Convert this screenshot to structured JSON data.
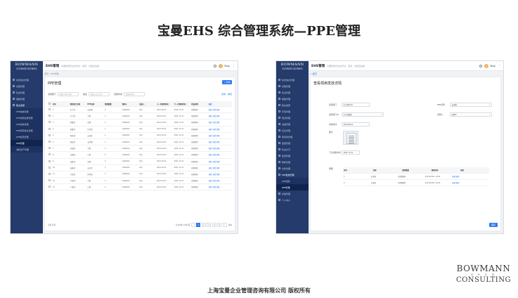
{
  "slide": {
    "title": "宝曼EHS  综合管理系统—PPE管理",
    "footer": "上海宝曼企业管理咨询有限公司 版权所有",
    "brand": {
      "line1": "BOWMANN",
      "line2": "B  E  D  H",
      "line3": "CONSULTING"
    }
  },
  "app": {
    "logo_line1": "BOWMANN",
    "logo_line2": "CONSULTING",
    "name": "EHS管理",
    "slogan": "手握使用安全的环境、职场、合规应提前",
    "user": "Tony",
    "more": "⋮"
  },
  "left": {
    "nav": [
      "综合信息管理",
      "合规管理",
      "隐患管理",
      "事故管理",
      "职业健康",
      "PPE发放管理",
      "PPE领用台账管理",
      "PPE品类管理",
      "PPE库存信息管理",
      "PPE检查管理",
      "PPE管理",
      "消防资产管理"
    ],
    "breadcrumb": "首页 / PPE管理",
    "panel_title": "PPE管理",
    "add_button": "+ 新增",
    "filters": [
      {
        "label": "领用部门",
        "placeholder": "请输入部门名称"
      },
      {
        "label": "姓名",
        "placeholder": "请输入员工姓名"
      },
      {
        "label": "领用时间",
        "placeholder": "请选择时间"
      }
    ],
    "search_button": "查询",
    "reset_button": "重置",
    "columns": [
      "序号",
      "领用部门名称",
      "PPE名称",
      "领用数量",
      "领用人",
      "发放人",
      "上一次领用时间",
      "下一次领用时间",
      "状态说明",
      "操作"
    ],
    "rows": [
      [
        "1",
        "生产部",
        "安全帽",
        "2",
        "LIANGDA",
        "GKJ",
        "2021.02.01",
        "2021.11.01",
        "按期领用",
        "编辑 查看 删除"
      ],
      [
        "2",
        "生产部",
        "手套",
        "3",
        "LIANGDA",
        "GKJ",
        "2021.02.01",
        "2021.11.01",
        "按期领用",
        "编辑 查看 删除"
      ],
      [
        "3",
        "质量部",
        "耳塞",
        "3",
        "LIANGDA",
        "GKJ",
        "2021.02.01",
        "2021.11.01",
        "按期领用",
        "编辑 查看 删除"
      ],
      [
        "4",
        "质量部",
        "护目镜",
        "1",
        "LIANGDA",
        "GKJ",
        "2021.02.01",
        "2021.11.01",
        "按期领用",
        "编辑 查看 删除"
      ],
      [
        "5",
        "物流部",
        "安全鞋",
        "1",
        "LIANGDA",
        "GKJ",
        "2021.02.01",
        "2021.11.01",
        "按期领用",
        "编辑 查看 删除"
      ],
      [
        "6",
        "物流部",
        "安全帽",
        "2",
        "LIANGDA",
        "GKJ",
        "2021.02.01",
        "2021.11.01",
        "按期领用",
        "编辑 查看 删除"
      ],
      [
        "7",
        "仓储部",
        "手套",
        "4",
        "LIANGDA",
        "GKJ",
        "2021.02.01",
        "2021.11.01",
        "按期领用",
        "编辑 查看 删除"
      ],
      [
        "8",
        "仓储部",
        "口罩",
        "5",
        "LIANGDA",
        "GKJ",
        "2021.02.01",
        "2021.11.01",
        "按期领用",
        "编辑 查看 删除"
      ],
      [
        "9",
        "设备部",
        "耳罩",
        "2",
        "LIANGDA",
        "GKJ",
        "2021.02.01",
        "2021.11.01",
        "按期领用",
        "编辑 查看 删除"
      ],
      [
        "10",
        "设备部",
        "安全带",
        "1",
        "LIANGDA",
        "GKJ",
        "2021.02.01",
        "2021.11.01",
        "按期领用",
        "编辑 查看 删除"
      ],
      [
        "11",
        "行政部",
        "防护服",
        "1",
        "LIANGDA",
        "GKJ",
        "2021.02.01",
        "2021.11.01",
        "按期领用",
        "编辑 查看 删除"
      ],
      [
        "12",
        "行政部",
        "手套",
        "3",
        "LIANGDA",
        "GKJ",
        "2021.02.01",
        "2021.11.01",
        "按期领用",
        "编辑 查看 删除"
      ],
      [
        "13",
        "人事部",
        "口罩",
        "2",
        "LIANGDA",
        "GKJ",
        "2021.02.01",
        "2021.11.01",
        "按期领用",
        "编辑 查看 删除"
      ]
    ],
    "pager": {
      "left": "全选  导出",
      "total": "共100条  10条/页",
      "pages": [
        "‹",
        "1",
        "2",
        "3",
        "4",
        "5",
        "›"
      ],
      "jump": "前往"
    }
  },
  "right": {
    "nav": [
      "综合信息管理",
      "合规管理",
      "隐患管理",
      "事故管理",
      "职业健康",
      "环境管理",
      "培训管理",
      "设备管理",
      "应急管理",
      "承包商管理",
      "变更管理",
      "作业许可",
      "检查管理",
      "审核管理",
      "文件管理",
      "PPE发放管理",
      "PPE领用",
      "PPE管理",
      "系统管理",
      "个人中心"
    ],
    "breadcrumb": "< 返回",
    "panel_title": "查看领用发放详情",
    "fields": [
      {
        "label": "领用部门",
        "value": "生产部Kiosk"
      },
      {
        "label": "PPE名称",
        "value": "安全帽"
      },
      {
        "label": "领用部门ID",
        "value": "生产部保留"
      },
      {
        "label": "领用人",
        "value": "张明华"
      },
      {
        "label": "领用时间",
        "value": "2021/02/01"
      },
      {
        "label": "图片",
        "value": ""
      },
      {
        "label": "下次领用时间",
        "value": "2021.11.01"
      }
    ],
    "detail_label": "明细",
    "detail_columns": [
      "序号",
      "名称",
      "领用数量",
      "领用时间",
      "操作"
    ],
    "detail_rows": [
      [
        "1",
        "安全帽",
        "领用数量2",
        "2021/02/01 10:00",
        "编辑 删除"
      ],
      [
        "2",
        "手套套",
        "领用数量3",
        "2021/02/01 10:00",
        "编辑 删除"
      ]
    ],
    "save_button": "保存"
  }
}
